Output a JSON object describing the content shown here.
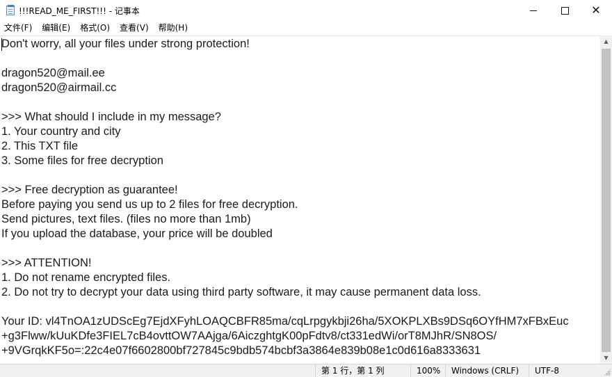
{
  "window": {
    "title": "!!!READ_ME_FIRST!!! - 记事本",
    "icon": "notepad-icon",
    "controls": {
      "minimize": "minimize-icon",
      "maximize": "maximize-icon",
      "close": "close-icon",
      "close_glyph": "✕"
    }
  },
  "menu": {
    "items": [
      {
        "label": "文件(F)"
      },
      {
        "label": "编辑(E)"
      },
      {
        "label": "格式(O)"
      },
      {
        "label": "查看(V)"
      },
      {
        "label": "帮助(H)"
      }
    ]
  },
  "document": {
    "lines": [
      "Don't worry, all your files under strong protection!",
      "",
      "dragon520@mail.ee",
      "dragon520@airmail.cc",
      "",
      ">>> What should I include in my message?",
      "1. Your country and city",
      "2. This TXT file",
      "3. Some files for free decryption",
      "",
      ">>> Free decryption as guarantee!",
      "Before paying you send us up to 2 files for free decryption.",
      "Send pictures, text files. (files no more than 1mb)",
      "If you upload the database, your price will be doubled",
      "",
      ">>> ATTENTION!",
      "1. Do not rename encrypted files.",
      "2. Do not try to decrypt your data using third party software, it may cause permanent data loss.",
      "",
      "Your ID: vl4TnOA1zUDScEg7EjdXFyhLOAQCBFR85ma/cqLrpgykbji26ha/5XOKPLXBs9DSq6OYfHM7xFBxEuc",
      "+g3Flww/kUuKDfe3FIEL7cB4ovttOW7AAjga/6AiczghtgK00pFdtv8/ct331edWi/orT8MJhR/SN8OS/",
      "+9VGrqkKF5o=:22c4e07f6602800bf727845c9bdb574bcbf3a3864e839b08e1c0d616a8333631"
    ]
  },
  "statusbar": {
    "position": "第 1 行，第 1 列",
    "zoom": "100%",
    "line_ending": "Windows (CRLF)",
    "encoding": "UTF-8"
  },
  "colors": {
    "background": "#ffffff",
    "statusbar": "#f0f0f0",
    "scroll_thumb": "#c2c2c2"
  }
}
